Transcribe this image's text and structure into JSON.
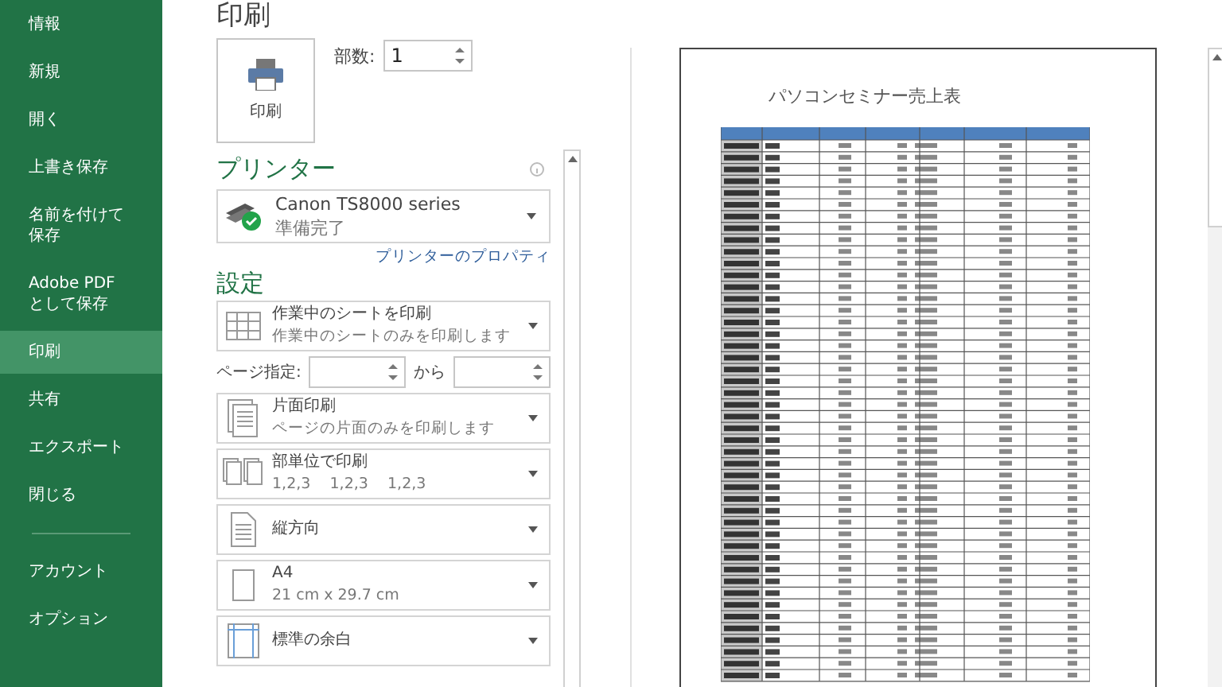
{
  "sidebar": {
    "items": [
      {
        "label": "情報",
        "selected": false
      },
      {
        "label": "新規",
        "selected": false
      },
      {
        "label": "開く",
        "selected": false
      },
      {
        "label": "上書き保存",
        "selected": false
      },
      {
        "label": "名前を付けて保存",
        "selected": false
      },
      {
        "label": "Adobe PDF として保存",
        "selected": false
      },
      {
        "label": "印刷",
        "selected": true
      },
      {
        "label": "共有",
        "selected": false
      },
      {
        "label": "エクスポート",
        "selected": false
      },
      {
        "label": "閉じる",
        "selected": false
      }
    ],
    "footer_items": [
      {
        "label": "アカウント",
        "selected": false
      },
      {
        "label": "オプション",
        "selected": false
      }
    ]
  },
  "title": "印刷",
  "print_button": {
    "label": "印刷"
  },
  "copies": {
    "label": "部数:",
    "value": "1"
  },
  "printer_section": {
    "heading": "プリンター",
    "name": "Canon TS8000 series",
    "status": "準備完了",
    "properties_link": "プリンターのプロパティ"
  },
  "settings_section": {
    "heading": "設定",
    "options": [
      {
        "kind": "sheets",
        "title": "作業中のシートを印刷",
        "subtitle": "作業中のシートのみを印刷します"
      },
      {
        "kind": "pages",
        "label": "ページ指定:",
        "to_label": "から"
      },
      {
        "kind": "sides",
        "title": "片面印刷",
        "subtitle": "ページの片面のみを印刷します"
      },
      {
        "kind": "collate",
        "title": "部単位で印刷",
        "subtitle": "1,2,3    1,2,3    1,2,3"
      },
      {
        "kind": "orientation",
        "title": "縦方向"
      },
      {
        "kind": "paper",
        "title": "A4",
        "subtitle": "21 cm x 29.7 cm"
      },
      {
        "kind": "margins",
        "title": "標準の余白"
      }
    ]
  },
  "preview": {
    "title": "パソコンセミナー売上表"
  }
}
